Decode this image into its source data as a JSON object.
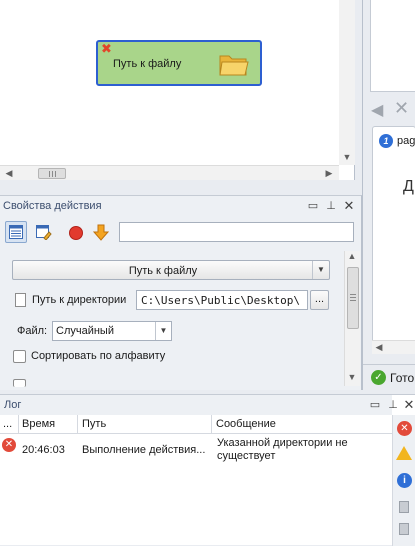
{
  "canvas": {
    "node": {
      "label": "Путь к файлу",
      "icon": "folder-icon",
      "status_icon": "error-x-icon"
    }
  },
  "right_panel": {
    "tab_label": "pag",
    "heading_partial": "Д",
    "status_text": "Гото"
  },
  "properties": {
    "title": "Свойства действия",
    "toolbar": {
      "icons": [
        "grid-view-icon",
        "edit-view-icon",
        "record-icon",
        "step-down-icon"
      ],
      "search_value": ""
    },
    "action_dropdown": {
      "value": "Путь к файлу"
    },
    "directory": {
      "label": "Путь к директории",
      "value": "C:\\Users\\Public\\Desktop\\",
      "browse_label": "..."
    },
    "file": {
      "label": "Файл:",
      "value": "Случайный"
    },
    "sort": {
      "label": "Сортировать по алфавиту",
      "checked": false
    }
  },
  "log": {
    "title": "Лог",
    "columns": [
      "...",
      "Время",
      "Путь",
      "Сообщение"
    ],
    "rows": [
      {
        "level": "error",
        "time": "20:46:03",
        "path": "Выполнение действия...",
        "message_line1": "Указанной директории не",
        "message_line2": "существует"
      }
    ],
    "side_icons": [
      "error-filter-icon",
      "warning-filter-icon",
      "info-filter-icon"
    ]
  },
  "colors": {
    "node_fill": "#a9d58a",
    "node_border": "#2d5fd1",
    "error": "#e24a3a",
    "ok": "#4aa72f"
  }
}
